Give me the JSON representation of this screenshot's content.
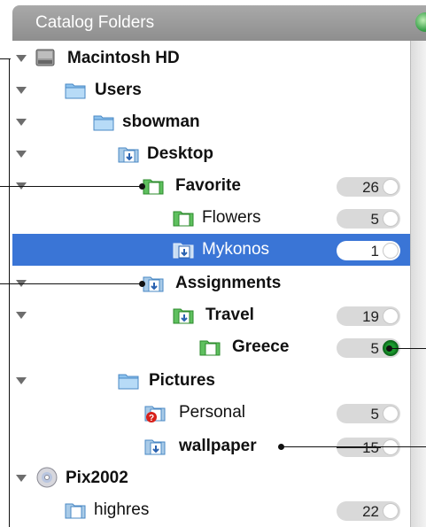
{
  "header": {
    "title": "Catalog Folders"
  },
  "rows": [
    {
      "name": "Macintosh HD",
      "icon": "hard-drive-icon",
      "bold": true,
      "count": ""
    },
    {
      "name": "Users",
      "icon": "folder-icon",
      "bold": true,
      "count": ""
    },
    {
      "name": "sbowman",
      "icon": "folder-icon",
      "bold": true,
      "count": ""
    },
    {
      "name": "Desktop",
      "icon": "document-folder-icon",
      "bold": true,
      "count": ""
    },
    {
      "name": "Favorite",
      "icon": "green-document-folder-icon",
      "bold": true,
      "count": "26"
    },
    {
      "name": "Flowers",
      "icon": "green-document-folder-icon",
      "bold": false,
      "count": "5"
    },
    {
      "name": "Mykonos",
      "icon": "document-folder-icon",
      "bold": false,
      "count": "1",
      "selected": true
    },
    {
      "name": "Assignments",
      "icon": "document-folder-icon",
      "bold": true,
      "count": ""
    },
    {
      "name": "Travel",
      "icon": "green-document-folder-icon",
      "bold": true,
      "count": "19"
    },
    {
      "name": "Greece",
      "icon": "green-document-folder-icon",
      "bold": true,
      "count": "5"
    },
    {
      "name": "Pictures",
      "icon": "folder-icon",
      "bold": true,
      "count": ""
    },
    {
      "name": "Personal",
      "icon": "document-folder-warning-icon",
      "bold": false,
      "count": "5"
    },
    {
      "name": "wallpaper",
      "icon": "document-folder-icon",
      "bold": true,
      "count": "15"
    },
    {
      "name": "Pix2002",
      "icon": "cd-disc-icon",
      "bold": true,
      "count": ""
    },
    {
      "name": "highres",
      "icon": "document-folder-icon",
      "bold": false,
      "count": "22"
    }
  ],
  "colors": {
    "selection": "#3a75d6",
    "green_status": "#1a9a2e"
  }
}
